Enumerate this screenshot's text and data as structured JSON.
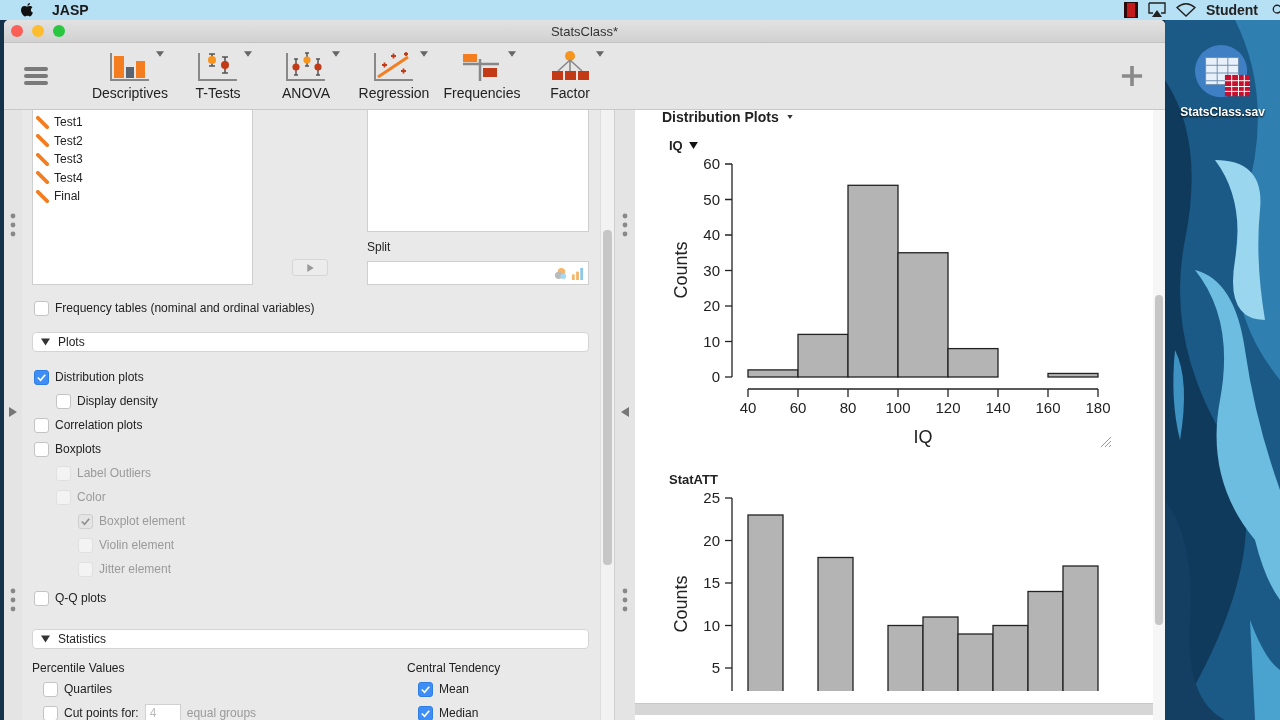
{
  "menubar": {
    "app": "JASP",
    "user": "Student"
  },
  "window": {
    "title": "StatsClass*"
  },
  "toolbar": [
    {
      "label": "Descriptives",
      "kind": "descriptives"
    },
    {
      "label": "T-Tests",
      "kind": "ttests"
    },
    {
      "label": "ANOVA",
      "kind": "anova"
    },
    {
      "label": "Regression",
      "kind": "regression"
    },
    {
      "label": "Frequencies",
      "kind": "frequencies"
    },
    {
      "label": "Factor",
      "kind": "factor"
    }
  ],
  "variables": [
    "Test1",
    "Test2",
    "Test3",
    "Test4",
    "Final"
  ],
  "split": {
    "label": "Split"
  },
  "frequency_tables": {
    "label": "Frequency tables (nominal and ordinal variables)",
    "checked": false
  },
  "plots": {
    "title": "Plots",
    "expanded": true,
    "options": [
      {
        "label": "Distribution plots",
        "checked": true,
        "disabled": false,
        "children": [
          {
            "label": "Display density",
            "checked": false,
            "disabled": false
          }
        ]
      },
      {
        "label": "Correlation plots",
        "checked": false,
        "disabled": false
      },
      {
        "label": "Boxplots",
        "checked": false,
        "disabled": false,
        "children": [
          {
            "label": "Label Outliers",
            "checked": false,
            "disabled": true
          },
          {
            "label": "Color",
            "checked": false,
            "disabled": true,
            "children": [
              {
                "label": "Boxplot element",
                "checked": true,
                "disabled": true
              },
              {
                "label": "Violin element",
                "checked": false,
                "disabled": true
              },
              {
                "label": "Jitter element",
                "checked": false,
                "disabled": true
              }
            ]
          }
        ]
      },
      {
        "label": "Q-Q plots",
        "checked": false,
        "disabled": false
      }
    ]
  },
  "statistics": {
    "title": "Statistics",
    "expanded": true,
    "percentile": {
      "title": "Percentile Values",
      "options": [
        {
          "label": "Quartiles",
          "checked": false
        }
      ],
      "cut_points": {
        "label": "Cut points for:",
        "value": "4",
        "suffix": "equal groups",
        "checked": false
      }
    },
    "central": {
      "title": "Central Tendency",
      "options": [
        {
          "label": "Mean",
          "checked": true
        },
        {
          "label": "Median",
          "checked": true
        }
      ]
    }
  },
  "results": {
    "title": "Distribution Plots",
    "plots": [
      {
        "chart_data": {
          "type": "bar",
          "title": "IQ",
          "xlabel": "IQ",
          "ylabel": "Counts",
          "x": [
            50,
            70,
            90,
            110,
            130,
            150,
            170
          ],
          "values": [
            2,
            12,
            54,
            35,
            8,
            0,
            1
          ],
          "xlim": [
            40,
            180
          ],
          "ylim": [
            0,
            60
          ],
          "xticks": [
            40,
            60,
            80,
            100,
            120,
            140,
            160,
            180
          ],
          "yticks": [
            0,
            10,
            20,
            30,
            40,
            50,
            60
          ]
        }
      },
      {
        "title": "StatATT",
        "ylabel": "Counts",
        "y_tick_labels": [
          "25",
          "20",
          "15",
          "10",
          "5"
        ]
      }
    ]
  },
  "desktop": {
    "file": "StatsClass.sav"
  }
}
